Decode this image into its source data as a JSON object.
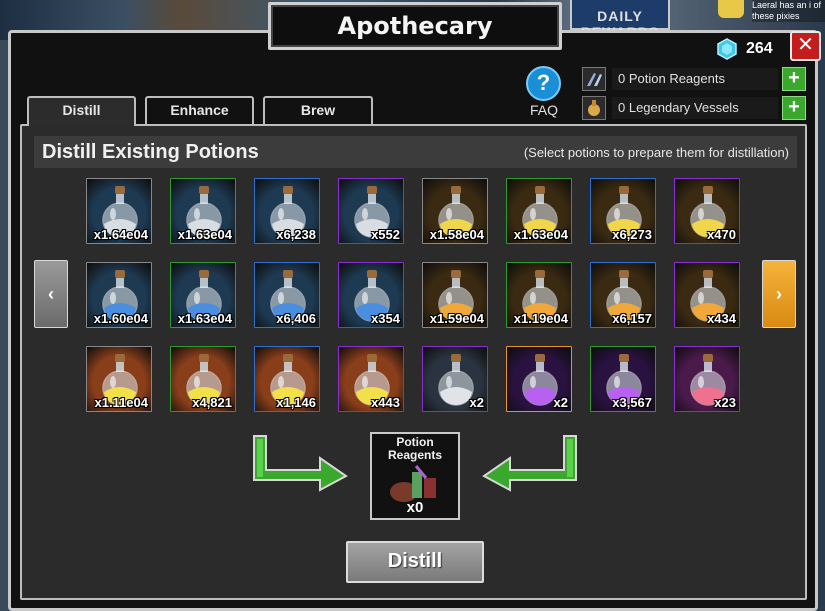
{
  "window": {
    "title": "Apothecary",
    "close_label": "✕"
  },
  "background": {
    "daily_rewards_label": "DAILY REWARDS",
    "note_text": "Laeral has an i of these pixies"
  },
  "currency": {
    "gems": "264",
    "icon": "gem-icon"
  },
  "faq": {
    "button_label": "?",
    "label": "FAQ"
  },
  "resources": [
    {
      "icon": "reagent-icon",
      "label": "0 Potion Reagents",
      "plus": "+"
    },
    {
      "icon": "vessel-icon",
      "label": "0 Legendary Vessels",
      "plus": "+"
    }
  ],
  "tabs": [
    {
      "label": "Distill",
      "active": true
    },
    {
      "label": "Enhance",
      "active": false
    },
    {
      "label": "Brew",
      "active": false
    }
  ],
  "panel": {
    "title": "Distill Existing Potions",
    "hint": "(Select potions to prepare them for distillation)"
  },
  "potions": [
    {
      "count": "x1.64e04",
      "liquid": "#d8dde2",
      "bg": "#1e3a52",
      "rarity": "#888888"
    },
    {
      "count": "x1.63e04",
      "liquid": "#d8dde2",
      "bg": "#1e3a52",
      "rarity": "#2f9b2f"
    },
    {
      "count": "x6,238",
      "liquid": "#d8dde2",
      "bg": "#1e3a52",
      "rarity": "#2f6fcf"
    },
    {
      "count": "x552",
      "liquid": "#d8dde2",
      "bg": "#1e3a52",
      "rarity": "#8a2fcf"
    },
    {
      "count": "x1.58e04",
      "liquid": "#f0d64a",
      "bg": "#3a2a12",
      "rarity": "#888888"
    },
    {
      "count": "x1.63e04",
      "liquid": "#f0d64a",
      "bg": "#3a2a12",
      "rarity": "#2f9b2f"
    },
    {
      "count": "x6,273",
      "liquid": "#f0d64a",
      "bg": "#3a2a12",
      "rarity": "#2f6fcf"
    },
    {
      "count": "x470",
      "liquid": "#f0d64a",
      "bg": "#3a2a12",
      "rarity": "#8a2fcf"
    },
    {
      "count": "x1.60e04",
      "liquid": "#4a8ee0",
      "bg": "#1e3a52",
      "rarity": "#888888"
    },
    {
      "count": "x1.63e04",
      "liquid": "#4a8ee0",
      "bg": "#1e3a52",
      "rarity": "#2f9b2f"
    },
    {
      "count": "x6,406",
      "liquid": "#4a8ee0",
      "bg": "#1e3a52",
      "rarity": "#2f6fcf"
    },
    {
      "count": "x354",
      "liquid": "#4a8ee0",
      "bg": "#1e3a52",
      "rarity": "#8a2fcf"
    },
    {
      "count": "x1.59e04",
      "liquid": "#f0a83a",
      "bg": "#3a2a12",
      "rarity": "#888888"
    },
    {
      "count": "x1.19e04",
      "liquid": "#f0a83a",
      "bg": "#3a2a12",
      "rarity": "#2f9b2f"
    },
    {
      "count": "x6,157",
      "liquid": "#f0a83a",
      "bg": "#3a2a12",
      "rarity": "#2f6fcf"
    },
    {
      "count": "x434",
      "liquid": "#f0a83a",
      "bg": "#3a2a12",
      "rarity": "#8a2fcf"
    },
    {
      "count": "x1.11e04",
      "liquid": "#f2e04a",
      "bg": "#8a3e1a",
      "rarity": "#888888"
    },
    {
      "count": "x4,821",
      "liquid": "#f2e04a",
      "bg": "#8a3e1a",
      "rarity": "#2f9b2f"
    },
    {
      "count": "x1,146",
      "liquid": "#f2e04a",
      "bg": "#8a3e1a",
      "rarity": "#2f6fcf"
    },
    {
      "count": "x443",
      "liquid": "#f2e04a",
      "bg": "#8a3e1a",
      "rarity": "#8a2fcf"
    },
    {
      "count": "x2",
      "liquid": "#e0e4e8",
      "bg": "#2a3440",
      "rarity": "#8a2fcf"
    },
    {
      "count": "x2",
      "liquid": "#b860f0",
      "bg": "#2a1240",
      "rarity": "#e8922a"
    },
    {
      "count": "x3,567",
      "liquid": "#b860f0",
      "bg": "#2a1240",
      "rarity": "#2f9b2f"
    },
    {
      "count": "x23",
      "liquid": "#f07090",
      "bg": "#4a1a4a",
      "rarity": "#8a2fcf"
    }
  ],
  "nav": {
    "left_label": "‹",
    "right_label": "›"
  },
  "output": {
    "label_line1": "Potion",
    "label_line2": "Reagents",
    "count": "x0"
  },
  "distill_button": {
    "label": "Distill"
  }
}
